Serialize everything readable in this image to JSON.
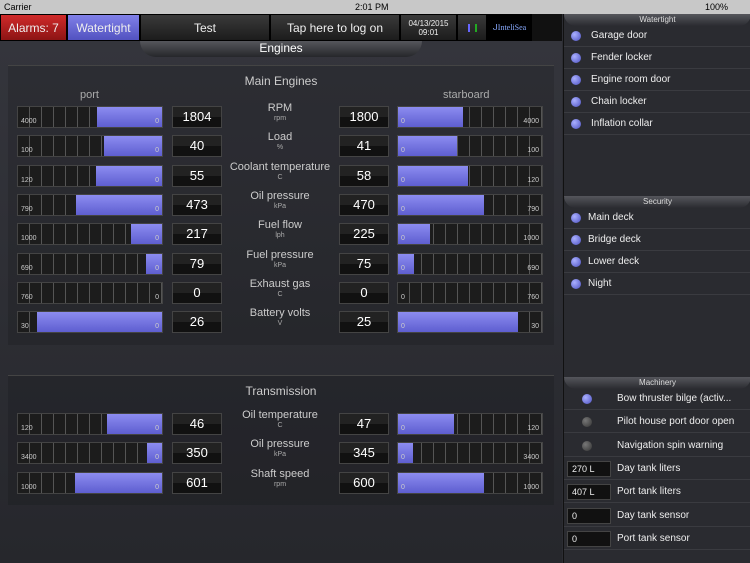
{
  "status": {
    "carrier": "Carrier",
    "time": "2:01 PM",
    "battery": "100%"
  },
  "topbar": {
    "alarms": "Alarms: 7",
    "watertight": "Watertight",
    "test": "Test",
    "logon": "Tap here to log on",
    "date": "04/13/2015",
    "clock": "09:01",
    "logo": "InteliSea"
  },
  "colors": {
    "alarm": "#b01c1c",
    "accent": "#6b6bd8"
  },
  "page_title": "Engines",
  "main": {
    "title": "Main Engines",
    "port": "port",
    "starboard": "starboard",
    "rows": [
      {
        "label": "RPM",
        "unit": "rpm",
        "max": "4000",
        "min": "0",
        "port": 1804,
        "stbd": 1800
      },
      {
        "label": "Load",
        "unit": "%",
        "max": "100",
        "min": "0",
        "port": 40,
        "stbd": 41
      },
      {
        "label": "Coolant temperature",
        "unit": "C",
        "max": "120",
        "min": "0",
        "port": 55,
        "stbd": 58
      },
      {
        "label": "Oil pressure",
        "unit": "kPa",
        "max": "790",
        "min": "0",
        "port": 473,
        "stbd": 470
      },
      {
        "label": "Fuel flow",
        "unit": "lph",
        "max": "1000",
        "min": "0",
        "port": 217,
        "stbd": 225
      },
      {
        "label": "Fuel pressure",
        "unit": "kPa",
        "max": "690",
        "min": "0",
        "port": 79,
        "stbd": 75
      },
      {
        "label": "Exhaust gas",
        "unit": "C",
        "max": "760",
        "min": "0",
        "port": 0,
        "stbd": 0
      },
      {
        "label": "Battery volts",
        "unit": "V",
        "max": "30",
        "min": "0",
        "port": 26,
        "stbd": 25
      }
    ]
  },
  "transmission": {
    "title": "Transmission",
    "rows": [
      {
        "label": "Oil temperature",
        "unit": "C",
        "max": "120",
        "min": "0",
        "port": 46,
        "stbd": 47
      },
      {
        "label": "Oil pressure",
        "unit": "kPa",
        "max": "3400",
        "min": "0",
        "port": 350,
        "stbd": 345
      },
      {
        "label": "Shaft speed",
        "unit": "rpm",
        "max": "1000",
        "min": "0",
        "port": 601,
        "stbd": 600
      }
    ]
  },
  "sidebar": {
    "watertight": {
      "title": "Watertight",
      "items": [
        {
          "label": "Garage door",
          "on": true
        },
        {
          "label": "Fender locker",
          "on": true
        },
        {
          "label": "Engine room door",
          "on": true
        },
        {
          "label": "Chain locker",
          "on": true
        },
        {
          "label": "Inflation collar",
          "on": true
        }
      ]
    },
    "security": {
      "title": "Security",
      "items": [
        {
          "label": "Main deck",
          "on": true
        },
        {
          "label": "Bridge deck",
          "on": true
        },
        {
          "label": "Lower deck",
          "on": true
        },
        {
          "label": "Night",
          "on": true
        }
      ]
    },
    "machinery": {
      "title": "Machinery",
      "items": [
        {
          "label": "Bow thruster bilge (activ...",
          "on": true
        },
        {
          "label": "Pilot house port door open",
          "on": false
        },
        {
          "label": "Navigation spin warning",
          "on": false
        },
        {
          "label": "Day tank liters",
          "value": "270 L"
        },
        {
          "label": "Port tank liters",
          "value": "407 L"
        },
        {
          "label": "Day tank sensor",
          "value": "0"
        },
        {
          "label": "Port tank sensor",
          "value": "0"
        }
      ]
    }
  }
}
